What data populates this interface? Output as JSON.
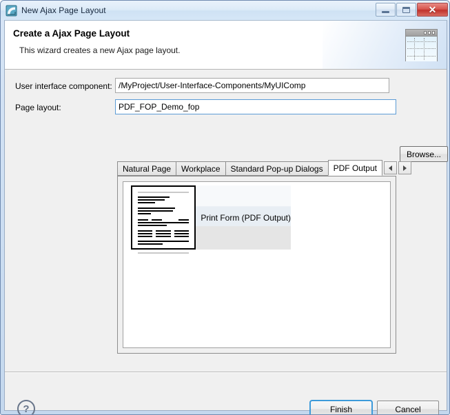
{
  "window": {
    "title": "New Ajax Page Layout",
    "title_icon": "ajax-layout-icon",
    "controls": {
      "minimize": "minimize-button",
      "maximize": "maximize-button",
      "close_glyph": "✕"
    }
  },
  "banner": {
    "title": "Create a Ajax Page Layout",
    "subtitle": "This wizard creates a new Ajax page layout.",
    "icon": "page-layout-banner-icon"
  },
  "form": {
    "component": {
      "label": "User interface component:",
      "value": "/MyProject/User-Interface-Components/MyUIComp",
      "placeholder": ""
    },
    "page_layout": {
      "label": "Page layout:",
      "value": "PDF_FOP_Demo_fop",
      "placeholder": "",
      "focused": true
    },
    "browse_label": "Browse..."
  },
  "tabs": {
    "items": [
      {
        "label": "Natural Page",
        "active": false
      },
      {
        "label": "Workplace",
        "active": false
      },
      {
        "label": "Standard Pop-up Dialogs",
        "active": false
      },
      {
        "label": "PDF Output",
        "active": true
      }
    ],
    "scroll_left": "◀",
    "scroll_right": "▶"
  },
  "gallery": {
    "items": [
      {
        "label": "Print Form (PDF Output)",
        "thumbnail": "document-preview-thumbnail",
        "selected": true
      }
    ]
  },
  "footer": {
    "help": "?",
    "finish_label": "Finish",
    "cancel_label": "Cancel"
  },
  "colors": {
    "accent": "#3c9ada",
    "titlebar": "#dbeaf7",
    "close_red": "#c0322c",
    "dialog_bg": "#f0f0f0"
  }
}
